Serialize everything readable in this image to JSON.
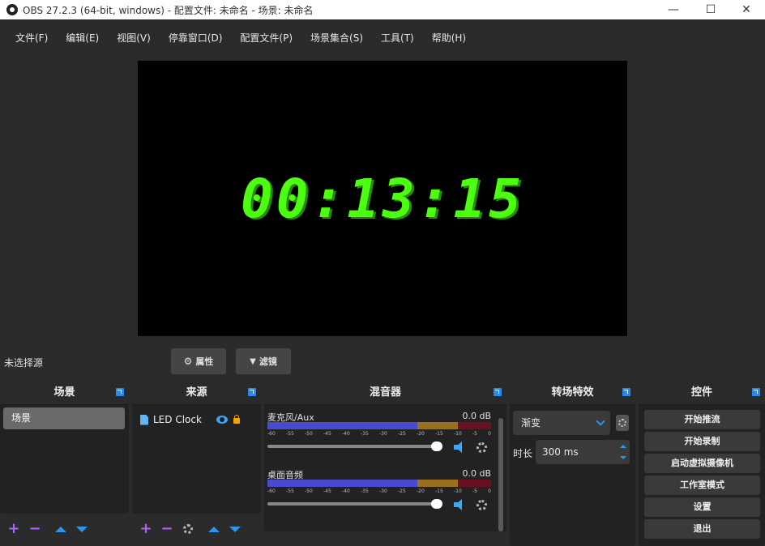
{
  "window": {
    "title": "OBS 27.2.3 (64-bit, windows) - 配置文件: 未命名 - 场景: 未命名",
    "controls": [
      "—",
      "☐",
      "✕"
    ]
  },
  "menu": [
    "文件(F)",
    "编辑(E)",
    "视图(V)",
    "停靠窗口(D)",
    "配置文件(P)",
    "场景集合(S)",
    "工具(T)",
    "帮助(H)"
  ],
  "preview": {
    "clock_text": "00:13:15"
  },
  "source_bar": {
    "no_selection": "未选择源",
    "properties": "属性",
    "filters": "滤镜"
  },
  "scenes": {
    "title": "场景",
    "items": [
      "场景"
    ]
  },
  "sources": {
    "title": "来源",
    "items": [
      {
        "name": "LED Clock",
        "icon": "file-icon"
      }
    ]
  },
  "mixer": {
    "title": "混音器",
    "ticks": [
      "-60",
      "-55",
      "-50",
      "-45",
      "-40",
      "-35",
      "-30",
      "-25",
      "-20",
      "-15",
      "-10",
      "-5",
      "0"
    ],
    "channels": [
      {
        "name": "麦克风/Aux",
        "db": "0.0 dB"
      },
      {
        "name": "桌面音频",
        "db": "0.0 dB"
      }
    ]
  },
  "transitions": {
    "title": "转场特效",
    "selected": "渐变",
    "duration_label": "时长",
    "duration_value": "300 ms"
  },
  "controls": {
    "title": "控件",
    "buttons": [
      "开始推流",
      "开始录制",
      "启动虚拟摄像机",
      "工作室模式",
      "设置",
      "退出"
    ]
  },
  "colors": {
    "accent": "#2b95f0",
    "clock": "#4cff12",
    "purple": "#b060ff"
  }
}
